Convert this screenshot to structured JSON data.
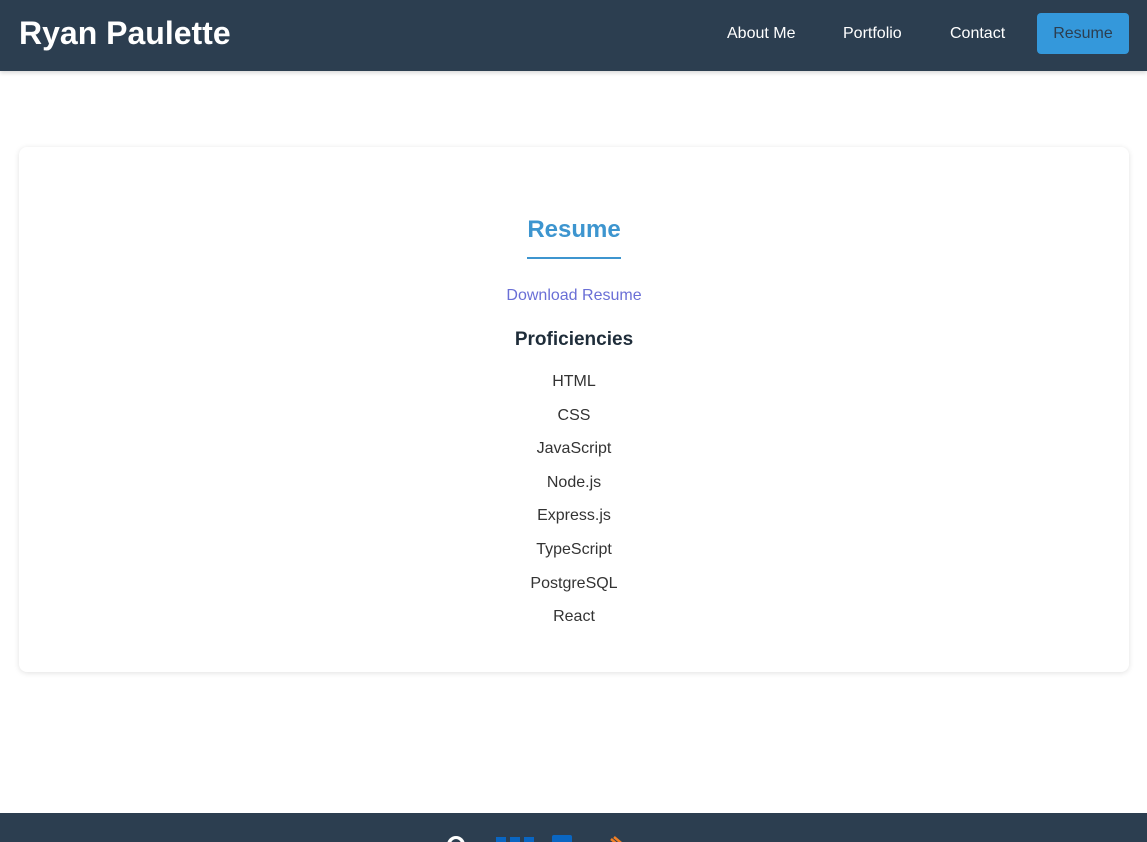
{
  "header": {
    "brand": "Ryan Paulette",
    "nav": {
      "about": "About Me",
      "portfolio": "Portfolio",
      "contact": "Contact",
      "resume": "Resume"
    }
  },
  "main": {
    "title": "Resume",
    "download_link": "Download Resume",
    "proficiencies_heading": "Proficiencies",
    "proficiencies": [
      "HTML",
      "CSS",
      "JavaScript",
      "Node.js",
      "Express.js",
      "TypeScript",
      "PostgreSQL",
      "React"
    ]
  },
  "footer": {
    "icons": [
      "github-icon",
      "linkedin-icon",
      "stack-overflow-icon"
    ]
  },
  "colors": {
    "header_bg": "#2c3e50",
    "accent": "#3498db",
    "title_blue": "#3d95cf",
    "link_purple": "#6a6fd6"
  }
}
